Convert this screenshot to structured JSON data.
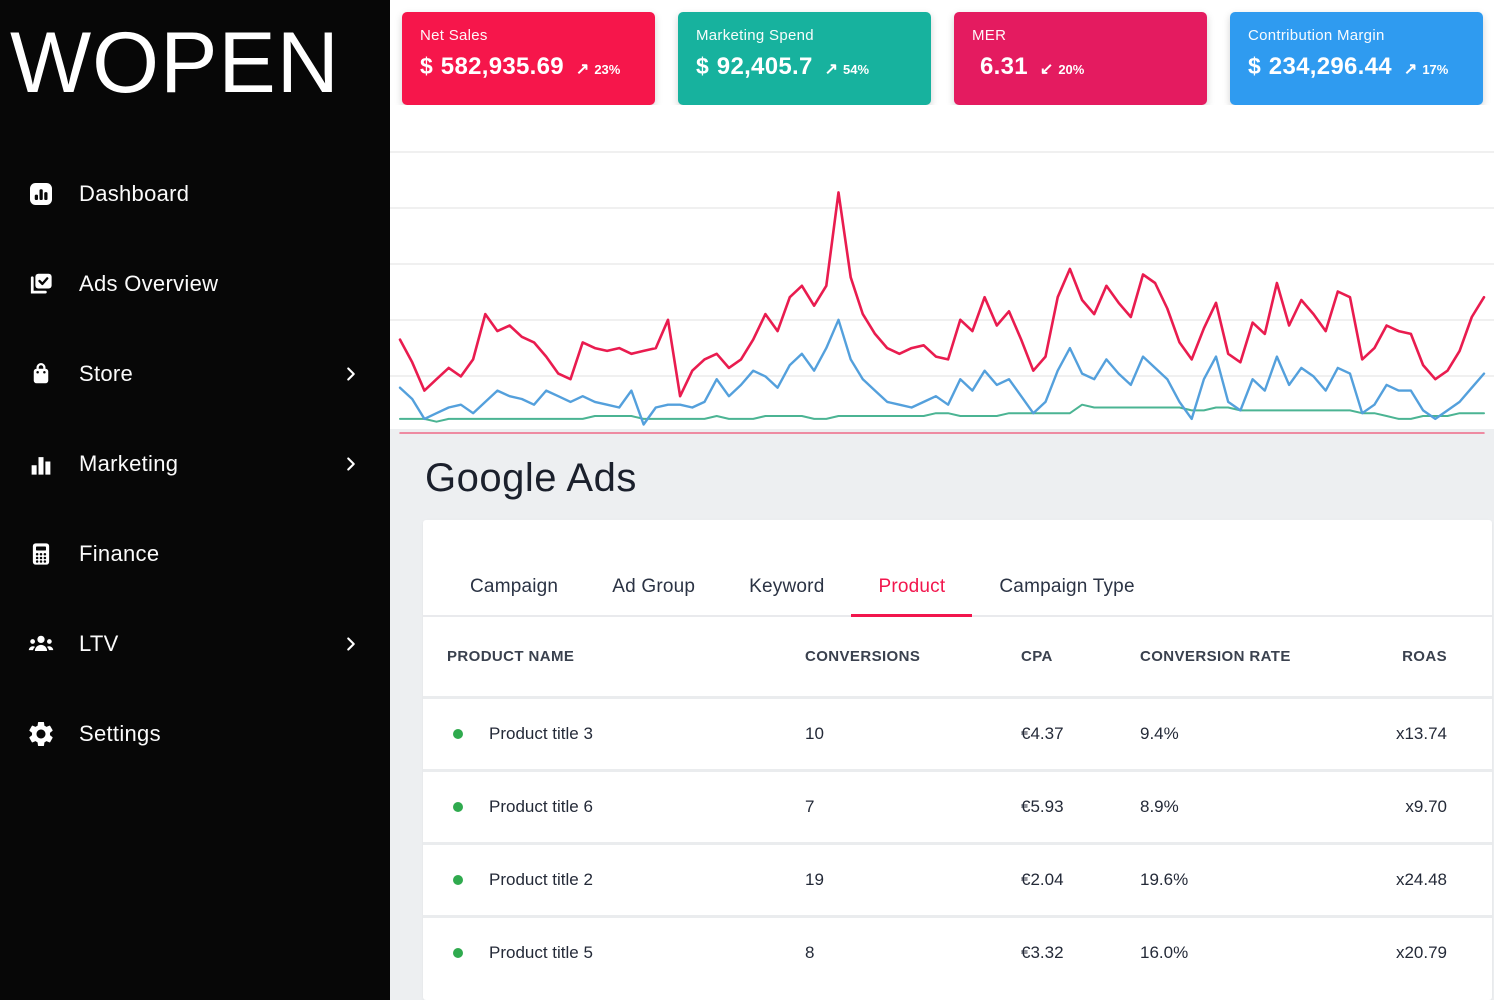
{
  "app": {
    "logo": "WOPEN"
  },
  "sidebar": {
    "items": [
      {
        "label": "Dashboard"
      },
      {
        "label": "Ads Overview"
      },
      {
        "label": "Store",
        "chevron": "›"
      },
      {
        "label": "Marketing",
        "chevron": "›"
      },
      {
        "label": "Finance"
      },
      {
        "label": "LTV",
        "chevron": "›"
      },
      {
        "label": "Settings"
      }
    ]
  },
  "kpi_cards": [
    {
      "label": "Net Sales",
      "currency": "$",
      "value": "582,935.69",
      "trend_arrow": "↗",
      "trend": "23%",
      "color": "#f6164b"
    },
    {
      "label": "Marketing Spend",
      "currency": "$",
      "value": "92,405.7",
      "trend_arrow": "↗",
      "trend": "54%",
      "color": "#17b29e"
    },
    {
      "label": "MER",
      "currency": "",
      "value": "6.31",
      "trend_arrow": "↙",
      "trend": "20%",
      "color": "#e41b60"
    },
    {
      "label": "Contribution Margin",
      "currency": "$",
      "value": "234,296.44",
      "trend_arrow": "↗",
      "trend": "17%",
      "color": "#2f9bf0"
    }
  ],
  "chart_data": {
    "type": "line",
    "title": "",
    "grid": "horizontal",
    "legend": false,
    "axis_labels_visible": false,
    "ylim": [
      0,
      100
    ],
    "series": [
      {
        "name": "flat-baseline",
        "color": "#ef6a88",
        "width": 1.5,
        "values": [
          0,
          0
        ]
      },
      {
        "name": "green-line",
        "color": "#4bb493",
        "width": 2,
        "values": [
          5,
          5,
          5,
          4,
          5,
          5,
          5,
          5,
          5,
          5,
          5,
          5,
          5,
          5,
          5,
          5,
          6,
          6,
          6,
          6,
          5,
          5,
          5,
          5,
          5,
          5,
          6,
          5,
          5,
          5,
          6,
          6,
          6,
          6,
          5,
          5,
          6,
          6,
          6,
          6,
          6,
          6,
          6,
          6,
          7,
          7,
          6,
          6,
          6,
          6,
          7,
          7,
          7,
          7,
          7,
          7,
          10,
          9,
          9,
          9,
          9,
          9,
          9,
          9,
          9,
          8,
          8,
          9,
          9,
          8,
          8,
          8,
          8,
          8,
          8,
          8,
          8,
          8,
          8,
          7,
          7,
          6,
          5,
          5,
          6,
          6,
          6,
          7,
          7,
          7
        ]
      },
      {
        "name": "blue-line",
        "color": "#54a0dc",
        "width": 2.4,
        "values": [
          16,
          12,
          5,
          7,
          9,
          10,
          7,
          11,
          15,
          13,
          12,
          10,
          15,
          13,
          11,
          13,
          11,
          10,
          9,
          15,
          3,
          9,
          10,
          10,
          9,
          11,
          19,
          13,
          17,
          22,
          20,
          16,
          24,
          28,
          22,
          30,
          40,
          26,
          19,
          15,
          11,
          10,
          9,
          11,
          13,
          10,
          19,
          15,
          22,
          17,
          19,
          13,
          7,
          11,
          22,
          30,
          21,
          19,
          26,
          21,
          17,
          27,
          23,
          19,
          11,
          5,
          19,
          27,
          11,
          8,
          19,
          15,
          27,
          17,
          23,
          20,
          15,
          23,
          21,
          7,
          10,
          17,
          15,
          15,
          8,
          5,
          8,
          11,
          16,
          21
        ]
      },
      {
        "name": "red-line",
        "color": "#e91c4f",
        "width": 2.6,
        "values": [
          33,
          25,
          15,
          19,
          23,
          20,
          26,
          42,
          36,
          38,
          34,
          32,
          27,
          21,
          19,
          32,
          30,
          29,
          30,
          28,
          29,
          30,
          40,
          13,
          22,
          26,
          28,
          23,
          26,
          33,
          42,
          36,
          48,
          52,
          45,
          52,
          85,
          55,
          42,
          35,
          30,
          28,
          30,
          31,
          27,
          26,
          40,
          36,
          48,
          38,
          43,
          33,
          22,
          27,
          48,
          58,
          47,
          42,
          52,
          46,
          41,
          56,
          53,
          44,
          32,
          26,
          37,
          46,
          28,
          25,
          39,
          35,
          53,
          38,
          47,
          42,
          36,
          50,
          48,
          26,
          30,
          38,
          36,
          35,
          24,
          19,
          22,
          29,
          41,
          48
        ]
      }
    ]
  },
  "google_ads": {
    "title": "Google Ads",
    "tabs": [
      {
        "label": "Campaign"
      },
      {
        "label": "Ad Group"
      },
      {
        "label": "Keyword"
      },
      {
        "label": "Product"
      },
      {
        "label": "Campaign Type"
      }
    ],
    "table": {
      "headers": [
        "PRODUCT NAME",
        "CONVERSIONS",
        "CPA",
        "CONVERSION RATE",
        "ROAS"
      ],
      "rows": [
        {
          "name": "Product title 3",
          "conversions": "10",
          "cpa": "€4.37",
          "conversion_rate": "9.4%",
          "roas": "x13.74"
        },
        {
          "name": "Product title 6",
          "conversions": "7",
          "cpa": "€5.93",
          "conversion_rate": "8.9%",
          "roas": "x9.70"
        },
        {
          "name": "Product title 2",
          "conversions": "19",
          "cpa": "€2.04",
          "conversion_rate": "19.6%",
          "roas": "x24.48"
        },
        {
          "name": "Product title 5",
          "conversions": "8",
          "cpa": "€3.32",
          "conversion_rate": "16.0%",
          "roas": "x20.79"
        }
      ]
    }
  }
}
